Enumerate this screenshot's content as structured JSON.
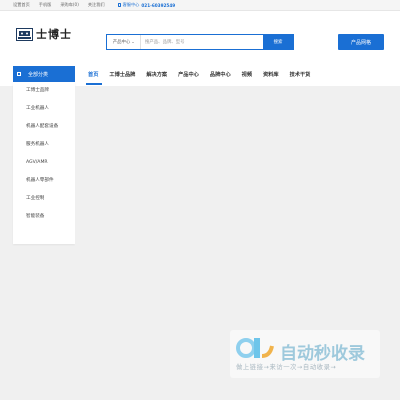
{
  "topbar": {
    "links": [
      "设置首页",
      "手机版",
      "采购车(0)",
      "关注我们"
    ],
    "service_label": "客服中心",
    "phone": "021-60392549"
  },
  "header": {
    "logo_text": "士博士",
    "search": {
      "category": "产品中心",
      "placeholder": "搜产品、品牌、型号",
      "button": "搜索"
    },
    "cta": "产品网格"
  },
  "nav": {
    "all_categories": "全部分类",
    "links": [
      "首页",
      "工博士品牌",
      "解决方案",
      "产品中心",
      "品牌中心",
      "视频",
      "资料库",
      "技术干货"
    ],
    "active_index": 0
  },
  "sidebar": {
    "items": [
      "工博士品牌",
      "工业机器人",
      "机器人配套设备",
      "服务机器人",
      "AGV/AMR",
      "机器人零部件",
      "工业控制",
      "智能装备"
    ]
  },
  "watermark": {
    "text": "自动秒收录",
    "subtext": "做上链接→来访一次→自动收录→"
  },
  "colors": {
    "accent": "#1a6fd4",
    "page_bg": "#f0f0f0"
  }
}
